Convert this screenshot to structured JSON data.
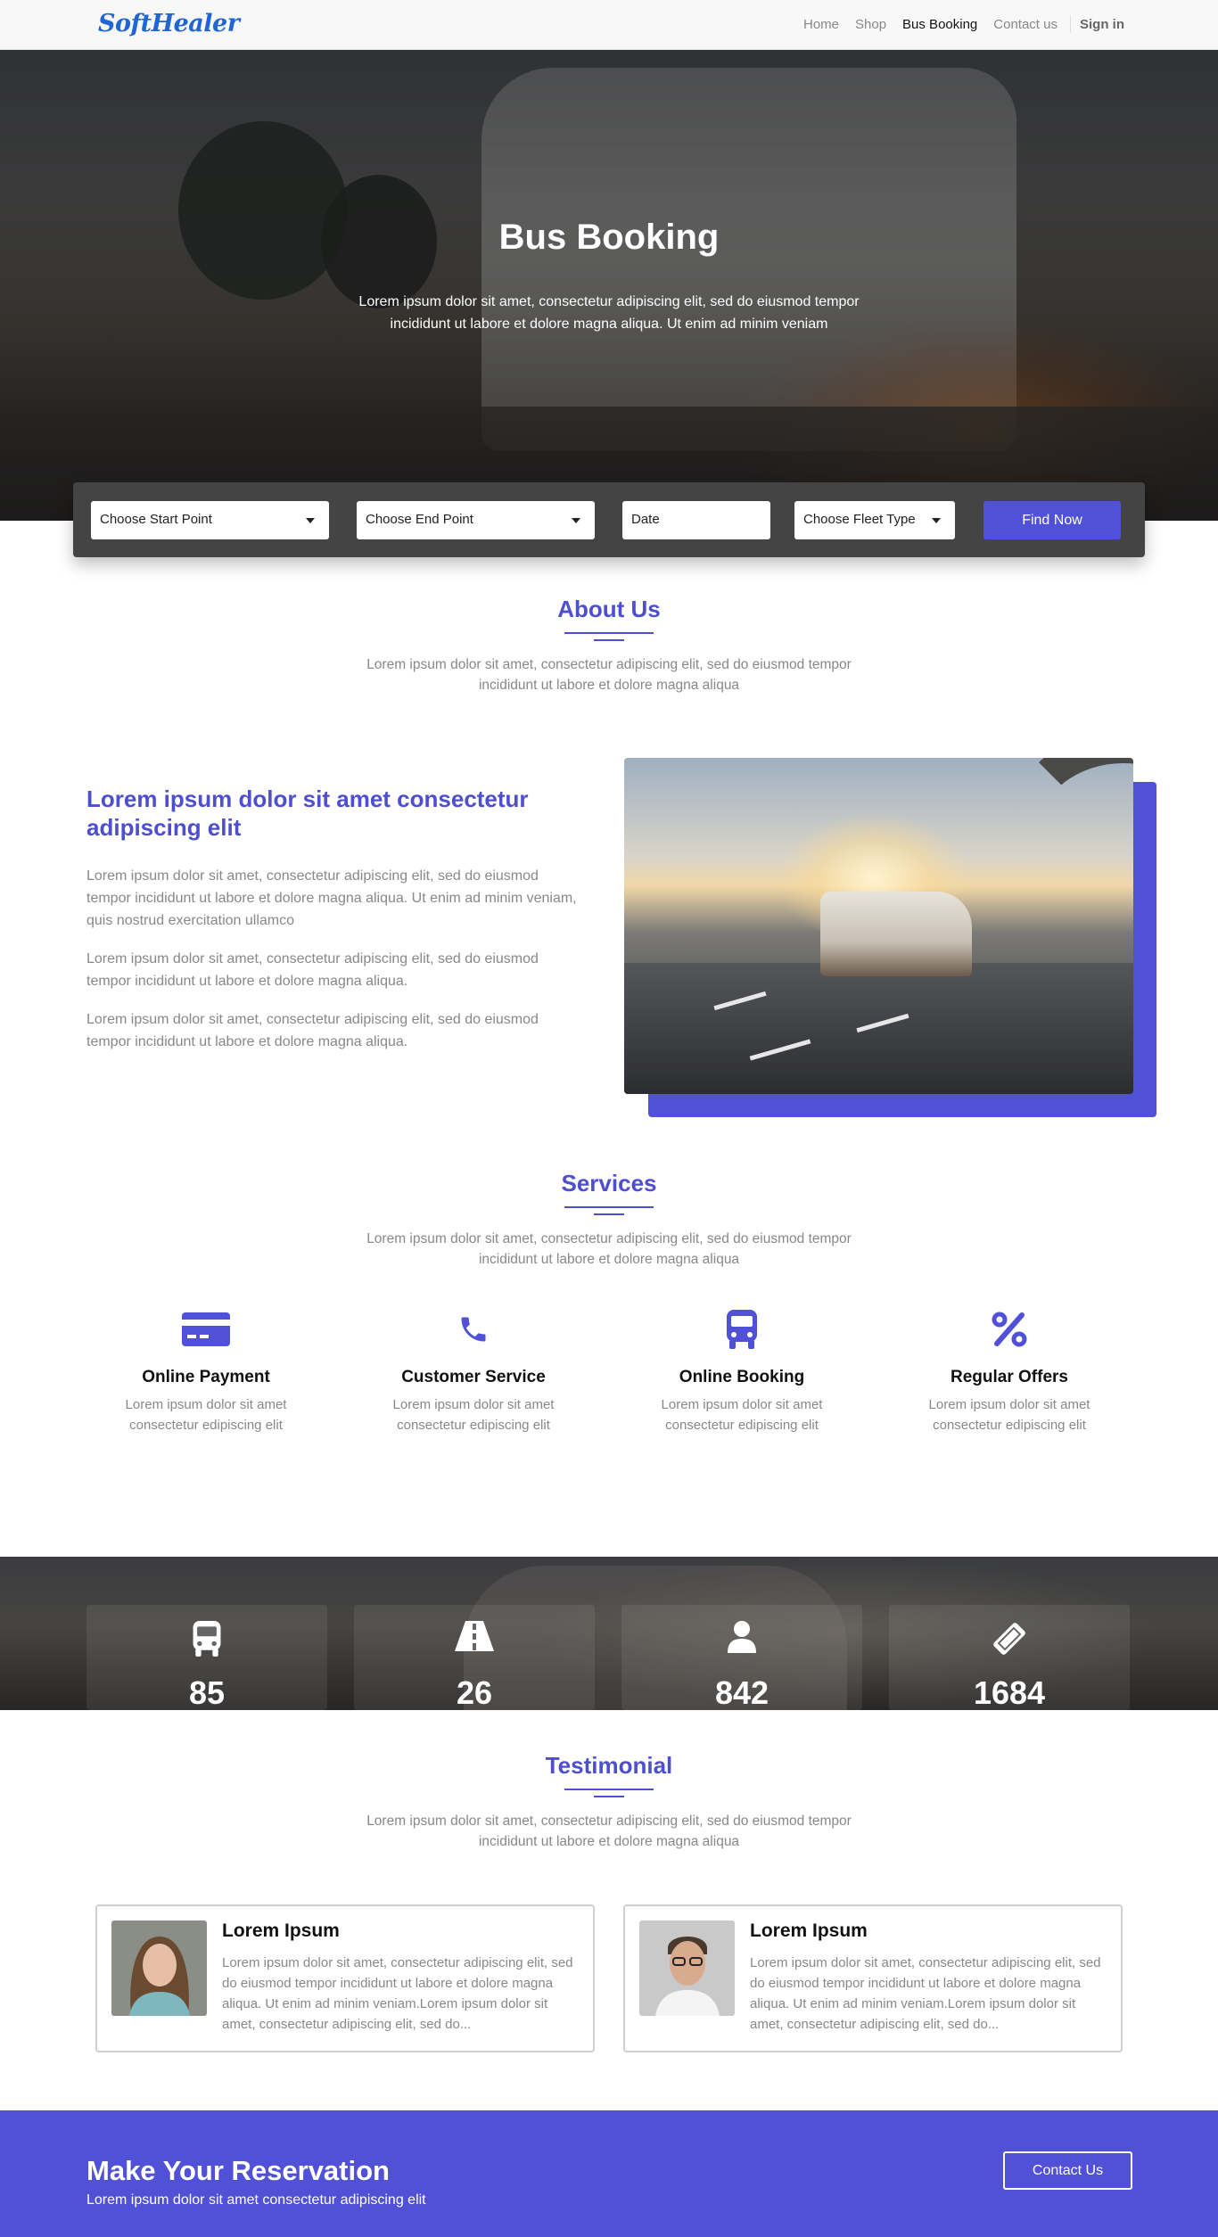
{
  "navbar": {
    "logo_text": "SoftHealer",
    "links": [
      "Home",
      "Shop",
      "Bus Booking",
      "Contact us"
    ],
    "active_index": 2,
    "signin": "Sign in"
  },
  "hero": {
    "title": "Bus Booking",
    "text": "Lorem ipsum dolor sit amet, consectetur adipiscing elit, sed do eiusmod tempor incididunt ut labore et dolore magna aliqua. Ut enim ad minim veniam"
  },
  "search": {
    "start_point": "Choose Start Point",
    "end_point": "Choose End Point",
    "date_placeholder": "Date",
    "fleet_type": "Choose Fleet Type",
    "button": "Find Now"
  },
  "about": {
    "title": "About Us",
    "description": "Lorem ipsum dolor sit amet, consectetur adipiscing elit, sed do eiusmod tempor incididunt ut labore et dolore magna aliqua",
    "heading": "Lorem ipsum dolor sit amet consectetur adipiscing elit",
    "paragraphs": [
      "Lorem ipsum dolor sit amet, consectetur adipiscing elit, sed do eiusmod tempor incididunt ut labore et dolore magna aliqua. Ut enim ad minim veniam, quis nostrud exercitation ullamco",
      "Lorem ipsum dolor sit amet, consectetur adipiscing elit, sed do eiusmod tempor incididunt ut labore et dolore magna aliqua.",
      "Lorem ipsum dolor sit amet, consectetur adipiscing elit, sed do eiusmod tempor incididunt ut labore et dolore magna aliqua."
    ]
  },
  "services": {
    "title": "Services",
    "description": "Lorem ipsum dolor sit amet, consectetur adipiscing elit, sed do eiusmod tempor incididunt ut labore et dolore magna aliqua",
    "items": [
      {
        "icon": "credit-card-icon",
        "title": "Online Payment",
        "text": "Lorem ipsum dolor sit amet consectetur edipiscing elit"
      },
      {
        "icon": "phone-icon",
        "title": "Customer Service",
        "text": "Lorem ipsum dolor sit amet consectetur edipiscing elit"
      },
      {
        "icon": "bus-icon",
        "title": "Online Booking",
        "text": "Lorem ipsum dolor sit amet consectetur edipiscing elit"
      },
      {
        "icon": "percent-icon",
        "title": "Regular Offers",
        "text": "Lorem ipsum dolor sit amet consectetur edipiscing elit"
      }
    ]
  },
  "stats": [
    {
      "icon": "bus-icon",
      "value": "85"
    },
    {
      "icon": "road-icon",
      "value": "26"
    },
    {
      "icon": "user-icon",
      "value": "842"
    },
    {
      "icon": "ticket-icon",
      "value": "1684"
    }
  ],
  "testimonial": {
    "title": "Testimonial",
    "description": "Lorem ipsum dolor sit amet, consectetur adipiscing elit, sed do eiusmod tempor incididunt ut labore et dolore magna aliqua",
    "cards": [
      {
        "name": "Lorem Ipsum",
        "text": "Lorem ipsum dolor sit amet, consectetur adipiscing elit, sed do eiusmod tempor incididunt ut labore et dolore magna aliqua. Ut enim ad minim veniam.Lorem ipsum dolor sit amet, consectetur adipiscing elit, sed do..."
      },
      {
        "name": "Lorem Ipsum",
        "text": "Lorem ipsum dolor sit amet, consectetur adipiscing elit, sed do eiusmod tempor incididunt ut labore et dolore magna aliqua. Ut enim ad minim veniam.Lorem ipsum dolor sit amet, consectetur adipiscing elit, sed do..."
      }
    ]
  },
  "cta": {
    "title": "Make Your Reservation",
    "text": "Lorem ipsum dolor sit amet consectetur adipiscing elit",
    "button": "Contact Us"
  },
  "colors": {
    "accent": "#5051d7",
    "heading": "#4e4fcf",
    "logo": "#1f66d4",
    "search_bar": "#444444"
  }
}
